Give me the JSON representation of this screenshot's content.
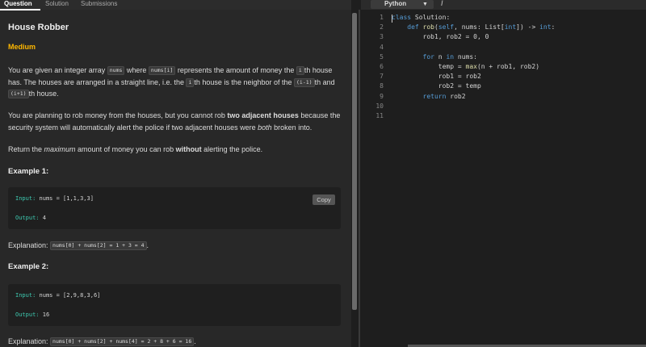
{
  "tabs": [
    {
      "label": "Question"
    },
    {
      "label": "Solution"
    },
    {
      "label": "Submissions"
    }
  ],
  "problem": {
    "title": "House Robber",
    "difficulty": "Medium",
    "p1": {
      "a": "You are given an integer array ",
      "code1": "nums",
      "b": " where ",
      "code2": "nums[i]",
      "c": " represents the amount of money the ",
      "code3": "i",
      "d": "th house has. The houses are arranged in a straight line, i.e. the ",
      "code4": "i",
      "e": "th house is the neighbor of the ",
      "code5": "(i-1)",
      "f": "th and ",
      "code6": "(i+1)",
      "g": "th house."
    },
    "p2": {
      "a": "You are planning to rob money from the houses, but you cannot rob ",
      "bold": "two adjacent houses",
      "b": " because the security system will automatically alert the police if two adjacent houses were ",
      "em": "both",
      "c": " broken into."
    },
    "p3": {
      "a": "Return the ",
      "em": "maximum",
      "b": " amount of money you can rob ",
      "bold": "without",
      "c": " alerting the police."
    },
    "examples": [
      {
        "heading": "Example 1:",
        "input_label": "Input:",
        "input_value": " nums = [1,1,3,3]",
        "output_label": "Output:",
        "output_value": " 4",
        "copy_label": "Copy",
        "explanation_label": "Explanation: ",
        "explanation_code": "nums[0] + nums[2] = 1 + 3 = 4",
        "explanation_tail": "."
      },
      {
        "heading": "Example 2:",
        "input_label": "Input:",
        "input_value": " nums = [2,9,8,3,6]",
        "output_label": "Output:",
        "output_value": " 16",
        "explanation_label": "Explanation: ",
        "explanation_code": "nums[0] + nums[2] + nums[4] = 2 + 8 + 6 = 16",
        "explanation_tail": "."
      }
    ]
  },
  "editor": {
    "language": "Python",
    "line_numbers": [
      "1",
      "2",
      "3",
      "4",
      "5",
      "6",
      "7",
      "8",
      "9",
      "10",
      "11"
    ],
    "lines": [
      [
        {
          "t": "class",
          "c": "kw"
        },
        {
          "t": " Solution:",
          "c": ""
        }
      ],
      [
        {
          "t": "    ",
          "c": ""
        },
        {
          "t": "def",
          "c": "kw"
        },
        {
          "t": " ",
          "c": ""
        },
        {
          "t": "rob",
          "c": "fn"
        },
        {
          "t": "(",
          "c": ""
        },
        {
          "t": "self",
          "c": "kw"
        },
        {
          "t": ", nums: List[",
          "c": ""
        },
        {
          "t": "int",
          "c": "kw"
        },
        {
          "t": "]) -> ",
          "c": ""
        },
        {
          "t": "int",
          "c": "kw"
        },
        {
          "t": ":",
          "c": ""
        }
      ],
      [
        {
          "t": "        rob1, rob2 = 0, 0",
          "c": ""
        }
      ],
      [
        {
          "t": "",
          "c": ""
        }
      ],
      [
        {
          "t": "        ",
          "c": ""
        },
        {
          "t": "for",
          "c": "kw"
        },
        {
          "t": " n ",
          "c": ""
        },
        {
          "t": "in",
          "c": "kw"
        },
        {
          "t": " nums:",
          "c": ""
        }
      ],
      [
        {
          "t": "            temp = ",
          "c": ""
        },
        {
          "t": "max",
          "c": "fn"
        },
        {
          "t": "(n + rob1, rob2)",
          "c": ""
        }
      ],
      [
        {
          "t": "            rob1 = rob2",
          "c": ""
        }
      ],
      [
        {
          "t": "            rob2 = temp",
          "c": ""
        }
      ],
      [
        {
          "t": "        ",
          "c": ""
        },
        {
          "t": "return",
          "c": "kw"
        },
        {
          "t": " rob2",
          "c": ""
        }
      ],
      [
        {
          "t": "",
          "c": ""
        }
      ],
      [
        {
          "t": "",
          "c": ""
        }
      ]
    ]
  }
}
